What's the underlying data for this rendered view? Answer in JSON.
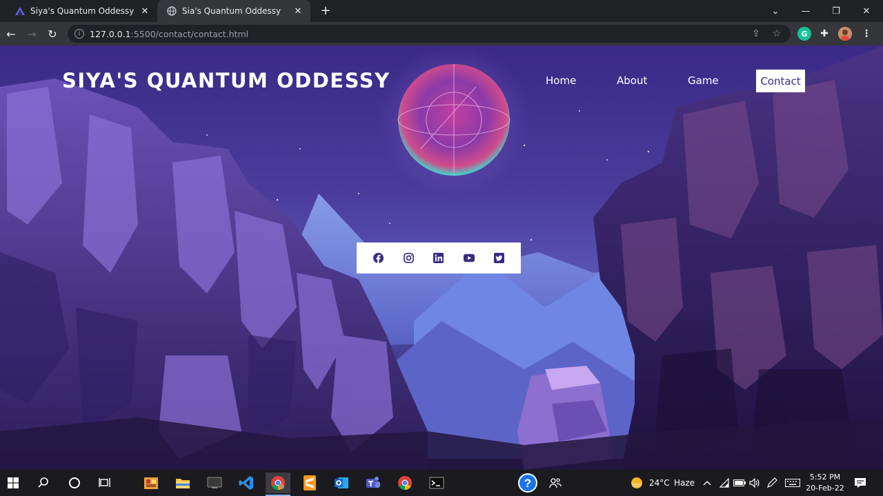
{
  "browser": {
    "tabs": [
      {
        "title": "Siya's Quantum Oddessy",
        "active": false
      },
      {
        "title": "Sia's Quantum Oddessy",
        "active": true
      }
    ],
    "new_tab": "+",
    "url": {
      "host": "127.0.0.1",
      "rest": ":5500/contact/contact.html"
    }
  },
  "site": {
    "title": "SIYA'S QUANTUM ODDESSY",
    "nav": {
      "home": "Home",
      "about": "About",
      "game": "Game",
      "contact": "Contact"
    },
    "active_nav": "Contact",
    "social_icons": [
      "facebook-icon",
      "instagram-icon",
      "linkedin-icon",
      "youtube-icon",
      "twitter-icon"
    ],
    "colors": {
      "accent": "#3a2a86",
      "nav_active_bg": "#ffffff"
    }
  },
  "taskbar": {
    "apps": [
      "windows-start",
      "search",
      "cortana",
      "task-view",
      "file-manager",
      "file-explorer",
      "app",
      "vscode",
      "chrome",
      "sublime-text",
      "outlook",
      "teams",
      "chrome",
      "terminal",
      "help",
      "people"
    ],
    "weather": {
      "temp": "24°C",
      "condition": "Haze"
    },
    "time": "5:52 PM",
    "date": "20-Feb-22"
  }
}
